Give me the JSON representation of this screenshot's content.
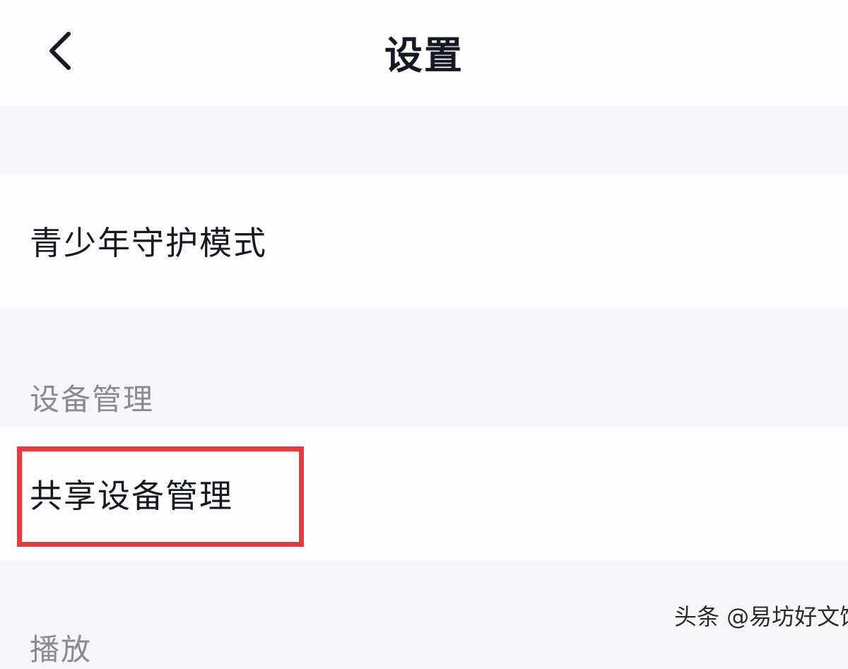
{
  "header": {
    "title": "设置",
    "back_icon": "chevron-left-icon"
  },
  "sections": {
    "account": {
      "items": [
        {
          "label": "青少年守护模式"
        }
      ]
    },
    "device_management": {
      "header": "设备管理",
      "items": [
        {
          "label": "共享设备管理",
          "highlighted": true
        }
      ]
    },
    "playback": {
      "header": "播放"
    }
  },
  "colors": {
    "background": "#f6f5f8",
    "row_background": "#fdfcfe",
    "text_primary": "#161823",
    "text_secondary": "#8a8b91",
    "highlight_border": "#e63a3f"
  },
  "watermark": {
    "text": "头条 @易坊好文馆"
  }
}
